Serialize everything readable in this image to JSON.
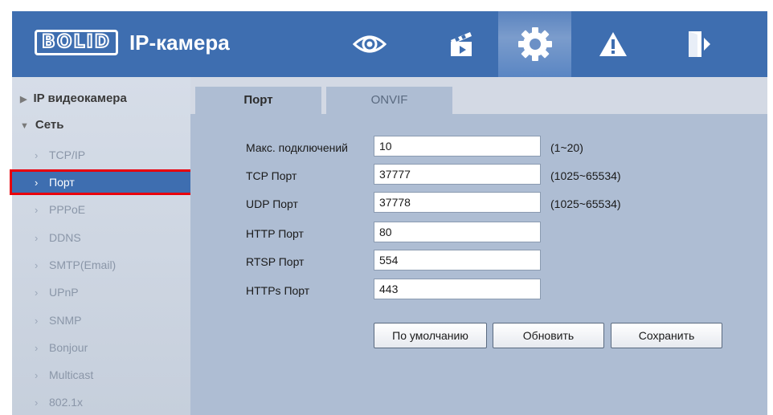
{
  "header": {
    "logo": "BOLID",
    "title": "IP-камера",
    "nav": [
      {
        "icon": "eye-icon"
      },
      {
        "icon": "clapperboard-icon"
      },
      {
        "icon": "gear-icon",
        "active": true
      },
      {
        "icon": "warning-icon"
      },
      {
        "icon": "exit-icon"
      }
    ]
  },
  "sidebar": {
    "sections": [
      {
        "label": "IP видеокамера",
        "expanded": false
      },
      {
        "label": "Сеть",
        "expanded": true
      }
    ],
    "items": [
      "TCP/IP",
      "Порт",
      "PPPoE",
      "DDNS",
      "SMTP(Email)",
      "UPnP",
      "SNMP",
      "Bonjour",
      "Multicast",
      "802.1x"
    ],
    "active_item": "Порт"
  },
  "tabs": [
    "Порт",
    "ONVIF"
  ],
  "form": {
    "rows": [
      {
        "label": "Макс. подключений",
        "value": "10",
        "hint": "(1~20)"
      },
      {
        "label": "TCP Порт",
        "value": "37777",
        "hint": "(1025~65534)"
      },
      {
        "label": "UDP Порт",
        "value": "37778",
        "hint": "(1025~65534)"
      },
      {
        "label": "HTTP Порт",
        "value": "80",
        "hint": ""
      },
      {
        "label": "RTSP Порт",
        "value": "554",
        "hint": ""
      },
      {
        "label": "HTTPs Порт",
        "value": "443",
        "hint": ""
      }
    ],
    "buttons": {
      "default": "По умолчанию",
      "refresh": "Обновить",
      "save": "Сохранить"
    }
  },
  "colors": {
    "header": "#3e6eb0",
    "active_item": "#3e6eb0",
    "highlight_border": "#e8000b",
    "panel": "#aebdd3"
  }
}
